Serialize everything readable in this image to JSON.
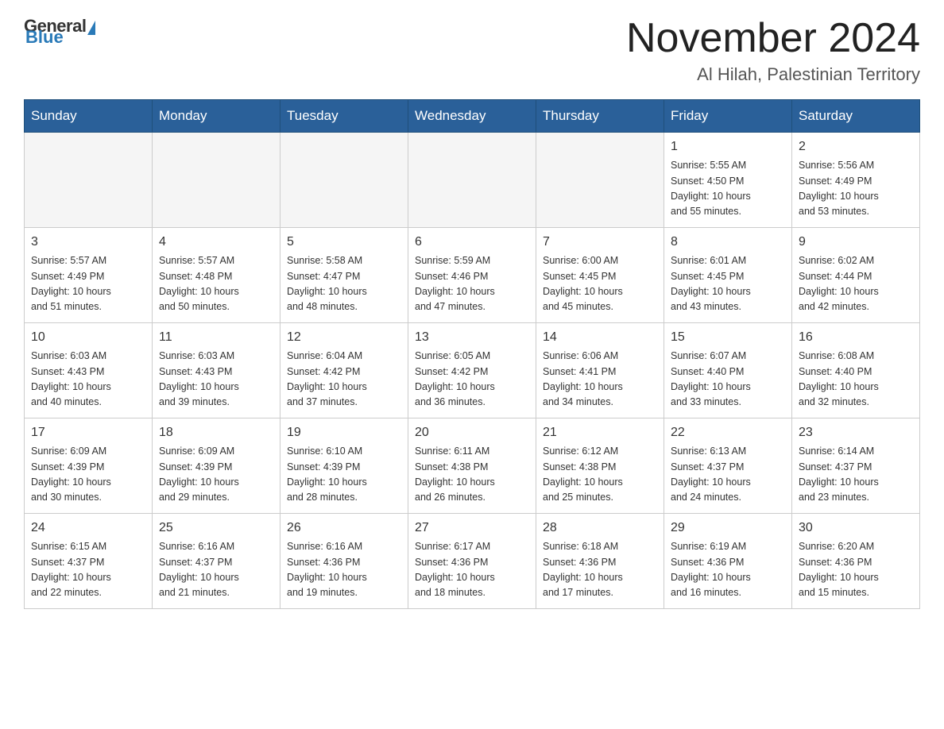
{
  "logo": {
    "general": "General",
    "blue": "Blue"
  },
  "header": {
    "month": "November 2024",
    "location": "Al Hilah, Palestinian Territory"
  },
  "weekdays": [
    "Sunday",
    "Monday",
    "Tuesday",
    "Wednesday",
    "Thursday",
    "Friday",
    "Saturday"
  ],
  "weeks": [
    [
      {
        "day": "",
        "info": ""
      },
      {
        "day": "",
        "info": ""
      },
      {
        "day": "",
        "info": ""
      },
      {
        "day": "",
        "info": ""
      },
      {
        "day": "",
        "info": ""
      },
      {
        "day": "1",
        "info": "Sunrise: 5:55 AM\nSunset: 4:50 PM\nDaylight: 10 hours\nand 55 minutes."
      },
      {
        "day": "2",
        "info": "Sunrise: 5:56 AM\nSunset: 4:49 PM\nDaylight: 10 hours\nand 53 minutes."
      }
    ],
    [
      {
        "day": "3",
        "info": "Sunrise: 5:57 AM\nSunset: 4:49 PM\nDaylight: 10 hours\nand 51 minutes."
      },
      {
        "day": "4",
        "info": "Sunrise: 5:57 AM\nSunset: 4:48 PM\nDaylight: 10 hours\nand 50 minutes."
      },
      {
        "day": "5",
        "info": "Sunrise: 5:58 AM\nSunset: 4:47 PM\nDaylight: 10 hours\nand 48 minutes."
      },
      {
        "day": "6",
        "info": "Sunrise: 5:59 AM\nSunset: 4:46 PM\nDaylight: 10 hours\nand 47 minutes."
      },
      {
        "day": "7",
        "info": "Sunrise: 6:00 AM\nSunset: 4:45 PM\nDaylight: 10 hours\nand 45 minutes."
      },
      {
        "day": "8",
        "info": "Sunrise: 6:01 AM\nSunset: 4:45 PM\nDaylight: 10 hours\nand 43 minutes."
      },
      {
        "day": "9",
        "info": "Sunrise: 6:02 AM\nSunset: 4:44 PM\nDaylight: 10 hours\nand 42 minutes."
      }
    ],
    [
      {
        "day": "10",
        "info": "Sunrise: 6:03 AM\nSunset: 4:43 PM\nDaylight: 10 hours\nand 40 minutes."
      },
      {
        "day": "11",
        "info": "Sunrise: 6:03 AM\nSunset: 4:43 PM\nDaylight: 10 hours\nand 39 minutes."
      },
      {
        "day": "12",
        "info": "Sunrise: 6:04 AM\nSunset: 4:42 PM\nDaylight: 10 hours\nand 37 minutes."
      },
      {
        "day": "13",
        "info": "Sunrise: 6:05 AM\nSunset: 4:42 PM\nDaylight: 10 hours\nand 36 minutes."
      },
      {
        "day": "14",
        "info": "Sunrise: 6:06 AM\nSunset: 4:41 PM\nDaylight: 10 hours\nand 34 minutes."
      },
      {
        "day": "15",
        "info": "Sunrise: 6:07 AM\nSunset: 4:40 PM\nDaylight: 10 hours\nand 33 minutes."
      },
      {
        "day": "16",
        "info": "Sunrise: 6:08 AM\nSunset: 4:40 PM\nDaylight: 10 hours\nand 32 minutes."
      }
    ],
    [
      {
        "day": "17",
        "info": "Sunrise: 6:09 AM\nSunset: 4:39 PM\nDaylight: 10 hours\nand 30 minutes."
      },
      {
        "day": "18",
        "info": "Sunrise: 6:09 AM\nSunset: 4:39 PM\nDaylight: 10 hours\nand 29 minutes."
      },
      {
        "day": "19",
        "info": "Sunrise: 6:10 AM\nSunset: 4:39 PM\nDaylight: 10 hours\nand 28 minutes."
      },
      {
        "day": "20",
        "info": "Sunrise: 6:11 AM\nSunset: 4:38 PM\nDaylight: 10 hours\nand 26 minutes."
      },
      {
        "day": "21",
        "info": "Sunrise: 6:12 AM\nSunset: 4:38 PM\nDaylight: 10 hours\nand 25 minutes."
      },
      {
        "day": "22",
        "info": "Sunrise: 6:13 AM\nSunset: 4:37 PM\nDaylight: 10 hours\nand 24 minutes."
      },
      {
        "day": "23",
        "info": "Sunrise: 6:14 AM\nSunset: 4:37 PM\nDaylight: 10 hours\nand 23 minutes."
      }
    ],
    [
      {
        "day": "24",
        "info": "Sunrise: 6:15 AM\nSunset: 4:37 PM\nDaylight: 10 hours\nand 22 minutes."
      },
      {
        "day": "25",
        "info": "Sunrise: 6:16 AM\nSunset: 4:37 PM\nDaylight: 10 hours\nand 21 minutes."
      },
      {
        "day": "26",
        "info": "Sunrise: 6:16 AM\nSunset: 4:36 PM\nDaylight: 10 hours\nand 19 minutes."
      },
      {
        "day": "27",
        "info": "Sunrise: 6:17 AM\nSunset: 4:36 PM\nDaylight: 10 hours\nand 18 minutes."
      },
      {
        "day": "28",
        "info": "Sunrise: 6:18 AM\nSunset: 4:36 PM\nDaylight: 10 hours\nand 17 minutes."
      },
      {
        "day": "29",
        "info": "Sunrise: 6:19 AM\nSunset: 4:36 PM\nDaylight: 10 hours\nand 16 minutes."
      },
      {
        "day": "30",
        "info": "Sunrise: 6:20 AM\nSunset: 4:36 PM\nDaylight: 10 hours\nand 15 minutes."
      }
    ]
  ]
}
